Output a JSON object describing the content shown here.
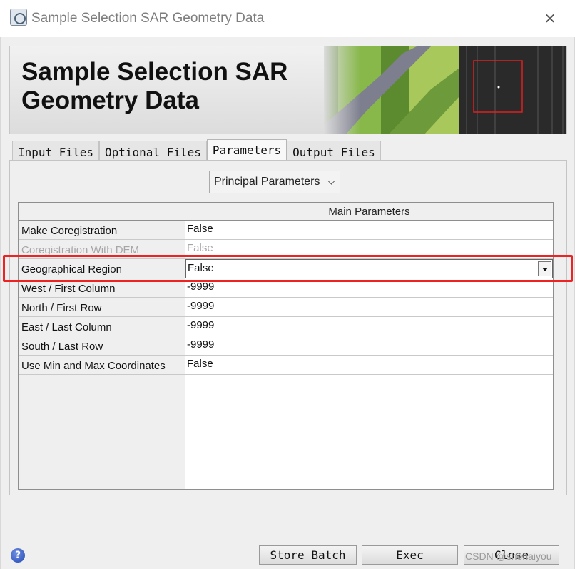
{
  "window": {
    "title": "Sample Selection SAR Geometry Data"
  },
  "banner": {
    "title": "Sample Selection SAR Geometry Data"
  },
  "tabs": [
    {
      "label": "Input Files"
    },
    {
      "label": "Optional Files"
    },
    {
      "label": "Parameters",
      "active": true
    },
    {
      "label": "Output Files"
    }
  ],
  "parameters": {
    "section_select": "Principal Parameters",
    "table_header": "Main Parameters",
    "rows": [
      {
        "label": "Make Coregistration",
        "value": "False"
      },
      {
        "label": "Coregistration With DEM",
        "value": "False",
        "disabled": true
      },
      {
        "label": "Geographical Region",
        "value": "False",
        "selected": true
      },
      {
        "label": "West / First Column",
        "value": "-9999"
      },
      {
        "label": "North / First Row",
        "value": "-9999"
      },
      {
        "label": "East / Last Column",
        "value": "-9999"
      },
      {
        "label": "South / Last Row",
        "value": "-9999"
      },
      {
        "label": "Use Min and Max Coordinates",
        "value": "False"
      }
    ]
  },
  "buttons": {
    "store_batch": "Store Batch",
    "exec": "Exec",
    "close": "Close"
  },
  "help_icon_glyph": "?",
  "watermark": "CSDN @shenaiyou",
  "colors": {
    "highlight": "#ee2222"
  }
}
